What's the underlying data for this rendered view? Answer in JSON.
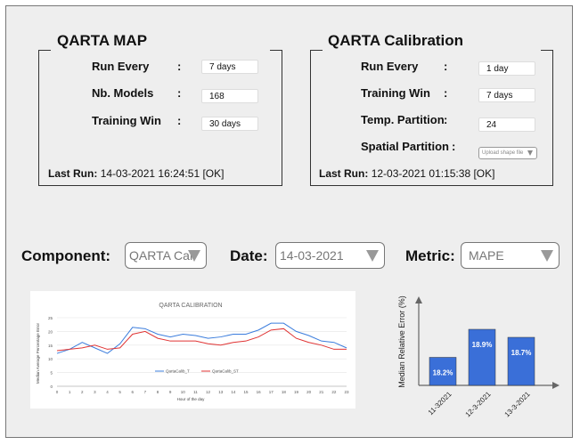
{
  "map_panel": {
    "title": "QARTA MAP",
    "rows": [
      {
        "label": "Run Every",
        "value": "7 days"
      },
      {
        "label": "Nb. Models",
        "value": "168"
      },
      {
        "label": "Training Win",
        "value": "30 days"
      }
    ],
    "last_run_label": "Last Run:",
    "last_run_value": "14-03-2021 16:24:51 [OK]"
  },
  "calib_panel": {
    "title": "QARTA Calibration",
    "rows": [
      {
        "label": "Run Every",
        "value": "1 day"
      },
      {
        "label": "Training Win",
        "value": "7 days"
      },
      {
        "label": "Temp. Partition",
        "value": "24"
      },
      {
        "label": "Spatial Partition",
        "value": "Upload shape file"
      }
    ],
    "last_run_label": "Last Run:",
    "last_run_value": "12-03-2021 01:15:38 [OK]"
  },
  "controls": {
    "component_label": "Component:",
    "component_value": "QARTA Cal",
    "date_label": "Date:",
    "date_value": "14-03-2021",
    "metric_label": "Metric:",
    "metric_value": "MAPE"
  },
  "colon": ":",
  "chart_data": [
    {
      "type": "line",
      "title": "QARTA CALIBRATION",
      "xlabel": "Hour of the day",
      "ylabel": "Median Average Percentage Error",
      "x": [
        0,
        1,
        2,
        3,
        4,
        5,
        6,
        7,
        8,
        9,
        10,
        11,
        12,
        13,
        14,
        15,
        16,
        17,
        18,
        19,
        20,
        21,
        22,
        23
      ],
      "ylim": [
        0,
        25
      ],
      "yticks": [
        0,
        5,
        10,
        15,
        20,
        25
      ],
      "series": [
        {
          "name": "QartaCalib_T",
          "color": "#3b7ddd",
          "values": [
            12,
            13.5,
            16,
            14,
            12,
            15.5,
            21.5,
            21,
            19,
            18,
            19,
            18.5,
            17.5,
            18,
            19,
            19,
            20.5,
            23,
            23,
            20,
            18.5,
            16.5,
            16,
            14
          ]
        },
        {
          "name": "QartaCalib_ST",
          "color": "#e03333",
          "values": [
            13,
            13.5,
            14,
            15,
            13.5,
            14,
            19,
            20,
            17.5,
            16.5,
            16.5,
            16.5,
            15.5,
            15,
            16,
            16.5,
            18,
            20.5,
            21,
            17.5,
            16,
            15,
            13.5,
            13.5
          ]
        }
      ]
    },
    {
      "type": "bar",
      "ylabel": "Median Relative Error (%)",
      "categories": [
        "11-32021",
        "12-3-2021",
        "13-3-2021"
      ],
      "values": [
        18.2,
        18.9,
        18.7
      ],
      "data_labels": [
        "18.2%",
        "18.9%",
        "18.7%"
      ],
      "ylim": [
        17.5,
        19.5
      ],
      "color": "#3a6fd8"
    }
  ]
}
